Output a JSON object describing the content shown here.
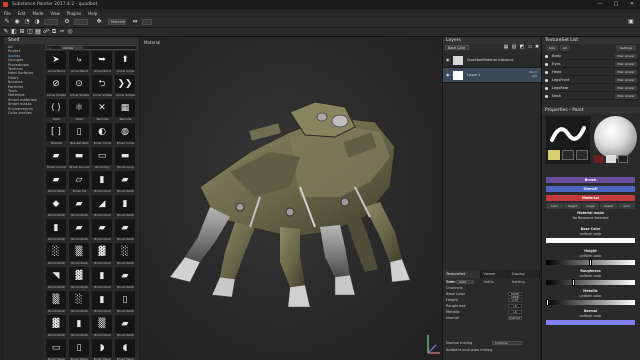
{
  "window": {
    "title": "Substance Painter 2017.4.2 - quadbot",
    "min": "—",
    "max": "□",
    "close": "✕"
  },
  "menu": [
    "File",
    "Edit",
    "Mode",
    "View",
    "Plugins",
    "Help"
  ],
  "toolbar": {
    "tools": [
      "paint-brush",
      "eraser",
      "projection",
      "geometry-mask",
      "smudge",
      "clone",
      "polygon-fill",
      "color-picker",
      "bake"
    ],
    "mode_select": "Material",
    "symmetry": "Symmetry"
  },
  "shelf": {
    "title": "Shelf",
    "categories": [
      "All",
      "Project",
      "Alphas",
      "Grunges",
      "Procedurals",
      "Textures",
      "Hard Surfaces",
      "Filters",
      "Brushes",
      "Particles",
      "Tools",
      "Materials",
      "Smart materials",
      "Smart masks",
      "Environments",
      "Color profiles"
    ],
    "active_category": "Alphas",
    "filter_pill": "Alphas",
    "items": [
      {
        "label": "Arrow Bend",
        "glyph": "➤"
      },
      {
        "label": "Arrow Bend",
        "glyph": "⤷"
      },
      {
        "label": "Arrow Bend",
        "glyph": "➥"
      },
      {
        "label": "Arrow Circle",
        "glyph": "⬆"
      },
      {
        "label": "Arrow Simple",
        "glyph": "⊘"
      },
      {
        "label": "Arrow Simple",
        "glyph": "⊙"
      },
      {
        "label": "Arrow Simple",
        "glyph": "⮌"
      },
      {
        "label": "Arrow Simple",
        "glyph": "❯❯"
      },
      {
        "label": "Atom",
        "glyph": "⟨ ⟩"
      },
      {
        "label": "Atom",
        "glyph": "⚛"
      },
      {
        "label": "Barcode",
        "glyph": "✕"
      },
      {
        "label": "Barcode",
        "glyph": "▦"
      },
      {
        "label": "Bracket",
        "glyph": "[ ]"
      },
      {
        "label": "Bracket Rect",
        "glyph": "▯"
      },
      {
        "label": "Brush Circle",
        "glyph": "◐"
      },
      {
        "label": "Brush Circle",
        "glyph": "◍"
      },
      {
        "label": "Brush Corner",
        "glyph": "▰"
      },
      {
        "label": "Brush Ground",
        "glyph": "▬"
      },
      {
        "label": "Brush Dry",
        "glyph": "▭"
      },
      {
        "label": "Brush Long",
        "glyph": "▬"
      },
      {
        "label": "Brush Wide",
        "glyph": "▰"
      },
      {
        "label": "Brush Ink",
        "glyph": "▱"
      },
      {
        "label": "Brush Paint",
        "glyph": "▮"
      },
      {
        "label": "Brush Paint",
        "glyph": "▰"
      },
      {
        "label": "Brush Paint",
        "glyph": "◆"
      },
      {
        "label": "Brush Paint",
        "glyph": "▰"
      },
      {
        "label": "Brush Paint",
        "glyph": "◢"
      },
      {
        "label": "Brush Paint",
        "glyph": "▮"
      },
      {
        "label": "Brush Paint",
        "glyph": "▮"
      },
      {
        "label": "Brush Paint",
        "glyph": "▰"
      },
      {
        "label": "Brush Paint",
        "glyph": "▰"
      },
      {
        "label": "Brush Paint",
        "glyph": "▰"
      },
      {
        "label": "Brush Paint",
        "glyph": "░"
      },
      {
        "label": "Brush Paint",
        "glyph": "▒"
      },
      {
        "label": "Brush Paint",
        "glyph": "▓"
      },
      {
        "label": "Brush Paint",
        "glyph": "░"
      },
      {
        "label": "Brush Paint",
        "glyph": "◥"
      },
      {
        "label": "Brush Paint",
        "glyph": "▓"
      },
      {
        "label": "Brush Paint",
        "glyph": "▮"
      },
      {
        "label": "Brush Paint",
        "glyph": "▰"
      },
      {
        "label": "Brush Paint",
        "glyph": "▒"
      },
      {
        "label": "Brush Paint",
        "glyph": "░"
      },
      {
        "label": "Brush Paint",
        "glyph": "▮"
      },
      {
        "label": "Brush Paint",
        "glyph": "▯"
      },
      {
        "label": "Brush Paint",
        "glyph": "▓"
      },
      {
        "label": "Brush Paint",
        "glyph": "▮"
      },
      {
        "label": "Brush Paint",
        "glyph": "▒"
      },
      {
        "label": "Brush Paint",
        "glyph": "▰"
      },
      {
        "label": "Brush Paper",
        "glyph": "▭"
      },
      {
        "label": "Brush Paper",
        "glyph": "▯"
      },
      {
        "label": "Brush Paper",
        "glyph": "◗"
      },
      {
        "label": "Brush Paper",
        "glyph": "◖"
      }
    ]
  },
  "viewport": {
    "label": "Material"
  },
  "layers": {
    "title": "Layers",
    "channel_select": "Base Color",
    "rows": [
      {
        "name": "QuadbotMaterial instance",
        "blend": "",
        "thumb": "#d8d8d8"
      },
      {
        "name": "Layer 1",
        "blend": "Norm\n100",
        "thumb": "#ffffff"
      }
    ]
  },
  "texset_settings": {
    "tabs": [
      "TextureSet Settin…",
      "Viewer Settin",
      "Display Setting"
    ],
    "active_tab": 0,
    "channels_label": "Channels",
    "size_label": "Size",
    "size_value": "2048",
    "channels": [
      {
        "name": "Base Color",
        "format": "RGB8 sRGB"
      },
      {
        "name": "Height",
        "format": "L16F"
      },
      {
        "name": "Roughness",
        "format": "L8"
      },
      {
        "name": "Metallic",
        "format": "L8"
      },
      {
        "name": "Normal",
        "format": "RGB16F"
      }
    ],
    "normal_mixing_label": "Normal mixing",
    "normal_mixing_value": "Combine",
    "ao_mixing_label": "Ambient occlusion mixing"
  },
  "texset_list": {
    "title": "TextureSet List",
    "solo": "Solo",
    "all": "All",
    "settings": "Settings",
    "rows": [
      {
        "name": "Body",
        "shader": "Main shader"
      },
      {
        "name": "Eyes",
        "shader": "Main shader"
      },
      {
        "name": "Head",
        "shader": "Main shader"
      },
      {
        "name": "LegsFront",
        "shader": "Main shader"
      },
      {
        "name": "LegsRear",
        "shader": "Main shader"
      },
      {
        "name": "Neck",
        "shader": "Main shader"
      }
    ]
  },
  "properties": {
    "title": "Properties - Paint",
    "sections": {
      "brush": "Brush",
      "stencil": "Stencil",
      "material": "Material"
    },
    "brush_thumbs": [
      "brush",
      "alpha",
      "stencil"
    ],
    "channel_buttons": [
      "color",
      "height",
      "rough",
      "metal",
      "nrm"
    ],
    "material_mode": "Material mode",
    "no_material": "No Resource Selected",
    "base_color": {
      "label": "Base Color",
      "sub": "uniform color",
      "color": "#ffffff"
    },
    "height": {
      "label": "Height",
      "sub": "uniform color",
      "value": 0.5
    },
    "roughness": {
      "label": "Roughness",
      "sub": "uniform color",
      "value": 0.3
    },
    "metallic": {
      "label": "Metallic",
      "sub": "uniform color",
      "value": 0.0
    },
    "normal": {
      "label": "Normal",
      "sub": "uniform color",
      "color": "#8080ff"
    },
    "colors": {
      "brush_bar": "#6a4d9d",
      "stencil_bar": "#4a66c0",
      "material_bar": "#c03a3a"
    }
  }
}
